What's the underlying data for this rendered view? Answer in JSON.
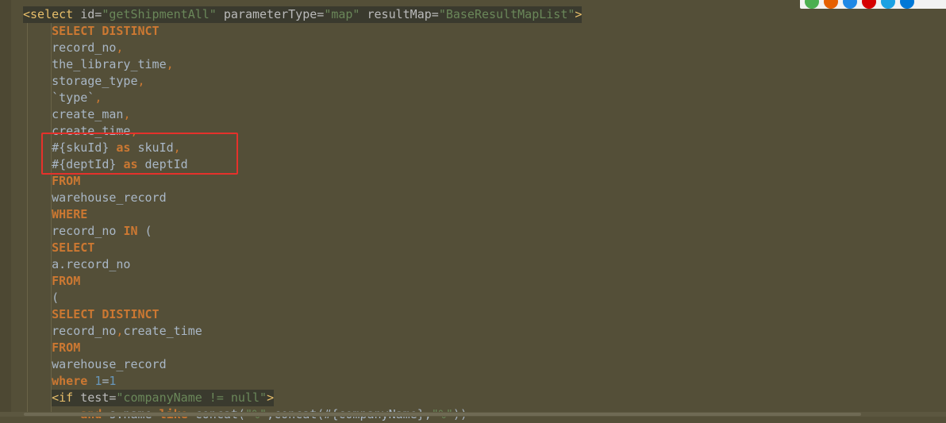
{
  "lines": [
    {
      "hl": true,
      "segs": [
        {
          "c": "t",
          "v": "<select"
        },
        {
          "c": "a",
          "v": " id="
        },
        {
          "c": "s",
          "v": "\"getShipmentAll\""
        },
        {
          "c": "a",
          "v": " parameterType="
        },
        {
          "c": "s",
          "v": "\"map\""
        },
        {
          "c": "a",
          "v": " resultMap="
        },
        {
          "c": "s",
          "v": "\"BaseResultMapList\""
        },
        {
          "c": "t",
          "v": ">"
        }
      ]
    },
    {
      "segs": [
        {
          "c": "x",
          "v": "    "
        },
        {
          "c": "k",
          "v": "SELECT DISTINCT"
        }
      ]
    },
    {
      "segs": [
        {
          "c": "x",
          "v": "    record_no"
        },
        {
          "c": "p",
          "v": ","
        }
      ]
    },
    {
      "segs": [
        {
          "c": "x",
          "v": "    the_library_time"
        },
        {
          "c": "p",
          "v": ","
        }
      ]
    },
    {
      "segs": [
        {
          "c": "x",
          "v": "    storage_type"
        },
        {
          "c": "p",
          "v": ","
        }
      ]
    },
    {
      "segs": [
        {
          "c": "x",
          "v": "    `type`"
        },
        {
          "c": "p",
          "v": ","
        }
      ]
    },
    {
      "segs": [
        {
          "c": "x",
          "v": "    create_man"
        },
        {
          "c": "p",
          "v": ","
        }
      ]
    },
    {
      "segs": [
        {
          "c": "x",
          "v": "    create_time"
        },
        {
          "c": "p",
          "v": ","
        }
      ]
    },
    {
      "segs": [
        {
          "c": "x",
          "v": "    #{skuId} "
        },
        {
          "c": "k",
          "v": "as"
        },
        {
          "c": "x",
          "v": " skuId"
        },
        {
          "c": "p",
          "v": ","
        }
      ]
    },
    {
      "segs": [
        {
          "c": "x",
          "v": "    #{deptId} "
        },
        {
          "c": "k",
          "v": "as"
        },
        {
          "c": "x",
          "v": " deptId"
        }
      ]
    },
    {
      "segs": [
        {
          "c": "x",
          "v": "    "
        },
        {
          "c": "k",
          "v": "FROM"
        }
      ]
    },
    {
      "segs": [
        {
          "c": "x",
          "v": "    warehouse_record"
        }
      ]
    },
    {
      "segs": [
        {
          "c": "x",
          "v": "    "
        },
        {
          "c": "k",
          "v": "WHERE"
        }
      ]
    },
    {
      "segs": [
        {
          "c": "x",
          "v": "    record_no "
        },
        {
          "c": "k",
          "v": "IN"
        },
        {
          "c": "x",
          "v": " ("
        }
      ]
    },
    {
      "segs": [
        {
          "c": "x",
          "v": "    "
        },
        {
          "c": "k",
          "v": "SELECT"
        }
      ]
    },
    {
      "segs": [
        {
          "c": "x",
          "v": "    a.record_no"
        }
      ]
    },
    {
      "segs": [
        {
          "c": "x",
          "v": "    "
        },
        {
          "c": "k",
          "v": "FROM"
        }
      ]
    },
    {
      "segs": [
        {
          "c": "x",
          "v": "    ("
        }
      ]
    },
    {
      "segs": [
        {
          "c": "x",
          "v": "    "
        },
        {
          "c": "k",
          "v": "SELECT DISTINCT"
        }
      ]
    },
    {
      "segs": [
        {
          "c": "x",
          "v": "    record_no"
        },
        {
          "c": "p",
          "v": ","
        },
        {
          "c": "x",
          "v": "create_time"
        }
      ]
    },
    {
      "segs": [
        {
          "c": "x",
          "v": "    "
        },
        {
          "c": "k",
          "v": "FROM"
        }
      ]
    },
    {
      "segs": [
        {
          "c": "x",
          "v": "    warehouse_record"
        }
      ]
    },
    {
      "segs": [
        {
          "c": "x",
          "v": "    "
        },
        {
          "c": "k",
          "v": "where"
        },
        {
          "c": "x",
          "v": " "
        },
        {
          "c": "n",
          "v": "1"
        },
        {
          "c": "x",
          "v": "="
        },
        {
          "c": "n",
          "v": "1"
        }
      ]
    },
    {
      "indent": "    ",
      "hl": true,
      "segs": [
        {
          "c": "t",
          "v": "<if"
        },
        {
          "c": "a",
          "v": " test="
        },
        {
          "c": "s",
          "v": "\"companyName != null\""
        },
        {
          "c": "t",
          "v": ">"
        }
      ]
    },
    {
      "segs": [
        {
          "c": "x",
          "v": "        "
        },
        {
          "c": "k",
          "v": "and"
        },
        {
          "c": "x",
          "v": " s.name "
        },
        {
          "c": "k",
          "v": "like"
        },
        {
          "c": "x",
          "v": " concat("
        },
        {
          "c": "s",
          "v": "\"%\""
        },
        {
          "c": "x",
          "v": ",concat(#{companyName},"
        },
        {
          "c": "s",
          "v": "\"%\""
        },
        {
          "c": "x",
          "v": "))"
        }
      ]
    }
  ],
  "browser_icons": [
    {
      "name": "chrome-icon",
      "color": "#4caf50"
    },
    {
      "name": "firefox-icon",
      "color": "#e66000"
    },
    {
      "name": "safari-icon",
      "color": "#1e88e5"
    },
    {
      "name": "opera-icon",
      "color": "#d50000"
    },
    {
      "name": "ie-icon",
      "color": "#1ba1e2"
    },
    {
      "name": "edge-icon",
      "color": "#0078d7"
    }
  ]
}
